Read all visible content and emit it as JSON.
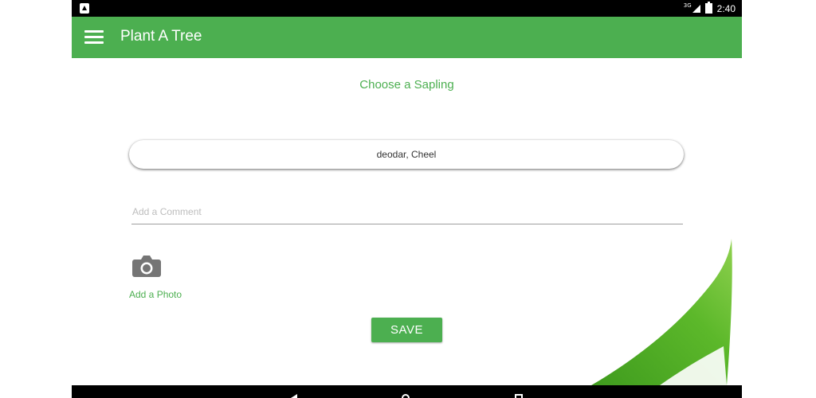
{
  "status_bar": {
    "network": "3G",
    "time": "2:40"
  },
  "app_bar": {
    "title": "Plant A Tree"
  },
  "form": {
    "section_title": "Choose a Sapling",
    "sapling_selected": "deodar, Cheel",
    "comment_placeholder": "Add a Comment",
    "comment_value": "",
    "add_photo_label": "Add a Photo",
    "save_label": "SAVE"
  },
  "icons": {
    "menu": "hamburger-menu-icon",
    "camera": "camera-icon",
    "back": "back-triangle-icon",
    "home": "home-circle-icon",
    "recent": "recent-apps-square-icon"
  },
  "colors": {
    "accent": "#4caf50",
    "status_bar": "#000000"
  }
}
